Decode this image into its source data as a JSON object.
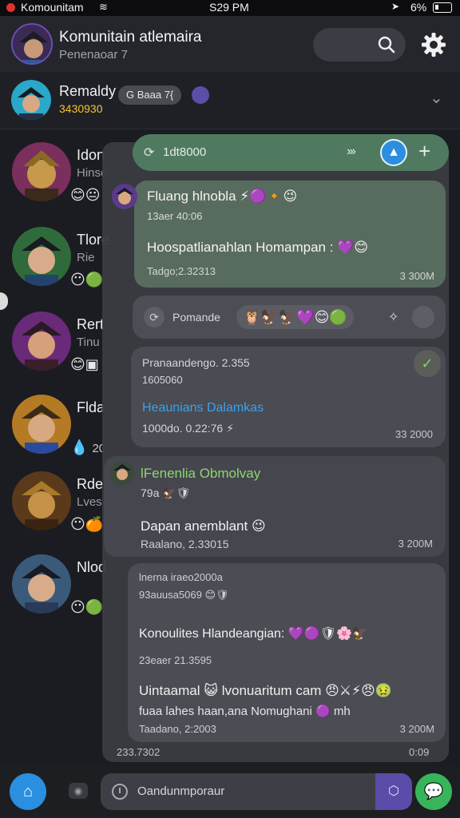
{
  "status_bar": {
    "carrier": "Komounitam",
    "time": "S29 PM",
    "battery": "6%"
  },
  "header": {
    "title": "Komunitain atlemaira",
    "subtitle": "Penenaoar 7"
  },
  "pinned": {
    "name": "Remaldy",
    "phone": "3430930",
    "chip": "G  Baaa 7{"
  },
  "chats": [
    {
      "name": "Idon",
      "preview": "Hinse",
      "emoji": "😊😐"
    },
    {
      "name": "Tlore",
      "preview": "Rie",
      "emoji": "😶🟢"
    },
    {
      "name": "Rert",
      "preview": "Tinu",
      "emoji": "😊▣"
    },
    {
      "name": "Flda",
      "preview": "",
      "emoji": "💧",
      "extra": "20"
    },
    {
      "name": "Rde",
      "preview": "Lvesaar",
      "emoji": "😶🍊"
    },
    {
      "name": "Nlod",
      "preview": "",
      "emoji": "😶🟢"
    }
  ],
  "quick_action": {
    "text": "1dt8000",
    "arrows": "›››"
  },
  "message1": {
    "name": "Fluang hlnobla",
    "name_emojis": "⚡🟣🔸😉",
    "sub": "13aer 40:06",
    "text": "Hoospatlianahlan Homampan :",
    "text_emojis": "💜😊",
    "meta": "Tadgo;2.32313",
    "count": "3 300M"
  },
  "reaction_bar": {
    "label": "Pomande",
    "emojis": "🦉🦅🦅💜😊🟢",
    "extra": "✧"
  },
  "message2": {
    "line1": "Pranaandengo. 2.355",
    "line2": "1605060",
    "link": "Heaunians Dalamkas",
    "meta": "1000do. 0.22:76",
    "meta_emoji": "⚡",
    "count": "33 2000"
  },
  "message3": {
    "name": "lFenenlia Obmolvay",
    "sub": "79a",
    "sub_emojis": "🦅🛡",
    "text": "Dapan anemblant",
    "text_emoji": "😉",
    "meta": "Raalano, 2.33015",
    "count": "3 200M"
  },
  "message4": {
    "line1": "lnerna iraeo2000a",
    "line2": "93auusa5069",
    "line2_emojis": "😊🛡",
    "text1": "Konoulites Hlandeangian:",
    "text1_emojis": "💜🟣🛡🌸🦅",
    "line4": "23eaer 21.3595",
    "text2": "Uintaamal",
    "text2_mid": "😺 lvonuaritum cam",
    "text2_emojis": "😠⚔⚡😠🤢",
    "text3": "fuaa lahes haan,ana Nomughani",
    "text3_emoji": "🟣",
    "text3_tail": "mh",
    "meta": "Taadano, 2:2003",
    "count": "3 200M"
  },
  "overlay_footer": {
    "left": "233.7302",
    "right": "0:09"
  },
  "composer": {
    "placeholder": "Oandunmporaur"
  },
  "colors": {
    "accent_blue": "#2a8fe0",
    "accent_green": "#38b55a",
    "accent_purple": "#5a4ca8",
    "phone_yellow": "#f2c431"
  }
}
